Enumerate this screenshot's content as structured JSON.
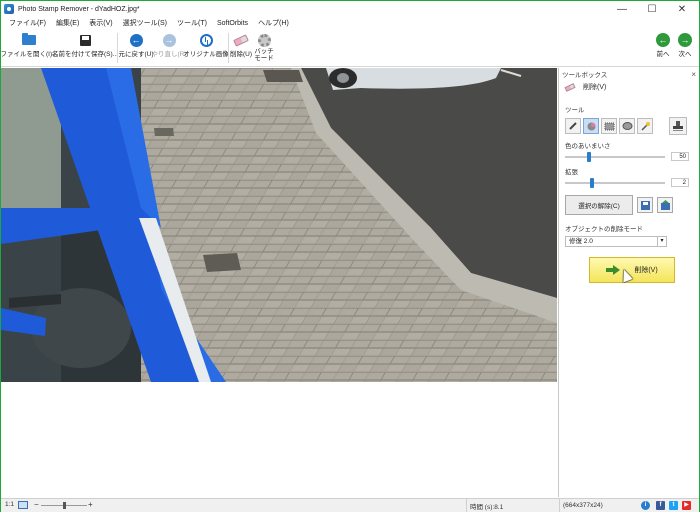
{
  "window": {
    "title": "Photo Stamp Remover - dYadHOZ.jpg*",
    "minimize_glyph": "—",
    "maximize_glyph": "☐",
    "close_glyph": "✕"
  },
  "menu": [
    "ファイル(F)",
    "編集(E)",
    "表示(V)",
    "選択ツール(S)",
    "ツール(T)",
    "SoftOrbits",
    "ヘルプ(H)"
  ],
  "toolbar": {
    "open": "ファイルを開く(I)...",
    "save_as": "名前を付けて保存(S)...",
    "undo": "元に戻す(U)",
    "redo": "やり直し(R)",
    "original": "オリジナル画像",
    "remove": "削除(U)",
    "batch_line1": "バッチ",
    "batch_line2": "モード",
    "prev": "前へ",
    "next": "次へ"
  },
  "toolbox": {
    "header": "ツールボックス",
    "close_glyph": "×",
    "section": "削除(V)",
    "tools_label": "ツール",
    "tolerance_label": "色のあいまいさ",
    "tolerance_value": "50",
    "tolerance_fraction": 0.22,
    "expand_label": "拡張",
    "expand_value": "2",
    "expand_fraction": 0.25,
    "clear_selection": "選択の解除(C)",
    "mode_label": "オブジェクトの削除モード",
    "mode_value": "修復 2.0",
    "remove_button": "削除(V)"
  },
  "statusbar": {
    "zoom_ratio": "1:1",
    "zoom_minus": "−",
    "zoom_plus": "+",
    "zoom_fraction": 0.5,
    "time": "時間 (s):8.1",
    "dimensions": "(664x377x24)"
  },
  "social": {
    "info": "i",
    "facebook": "f",
    "twitter": "t",
    "youtube": "▶"
  },
  "colors": {
    "window_border": "#1fa83a",
    "accent_blue": "#1f6fc6",
    "nav_green": "#2f9a3b",
    "remove_button": "#f4e45a"
  }
}
